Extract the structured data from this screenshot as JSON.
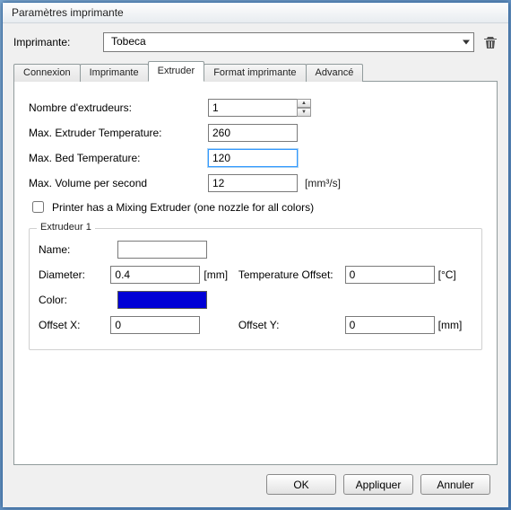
{
  "window": {
    "title": "Paramètres imprimante"
  },
  "printer_row": {
    "label": "Imprimante:",
    "selected": "Tobeca",
    "trash_icon": "delete-icon"
  },
  "tabs": {
    "items": [
      {
        "label": "Connexion"
      },
      {
        "label": "Imprimante"
      },
      {
        "label": "Extruder"
      },
      {
        "label": "Format imprimante"
      },
      {
        "label": "Advancé"
      }
    ],
    "active_index": 2
  },
  "extruder_form": {
    "num_extruders": {
      "label": "Nombre d'extrudeurs:",
      "value": "1"
    },
    "max_ext_temp": {
      "label": "Max. Extruder Temperature:",
      "value": "260"
    },
    "max_bed_temp": {
      "label": "Max. Bed Temperature:",
      "value": "120"
    },
    "max_vol_sec": {
      "label": "Max. Volume per second",
      "value": "12",
      "unit": "[mm³/s]"
    },
    "mixing_check": {
      "label": "Printer has a Mixing Extruder (one nozzle for all colors)",
      "checked": false
    }
  },
  "extruder_group": {
    "legend": "Extrudeur 1",
    "name": {
      "label": "Name:",
      "value": ""
    },
    "diameter": {
      "label": "Diameter:",
      "value": "0.4",
      "unit": "[mm]"
    },
    "temp_off": {
      "label": "Temperature Offset:",
      "value": "0",
      "unit": "[°C]"
    },
    "color": {
      "label": "Color:",
      "value": "#0000d6"
    },
    "offset_x": {
      "label": "Offset X:",
      "value": "0"
    },
    "offset_y": {
      "label": "Offset Y:",
      "value": "0",
      "unit": "[mm]"
    }
  },
  "buttons": {
    "ok": "OK",
    "apply": "Appliquer",
    "cancel": "Annuler"
  }
}
